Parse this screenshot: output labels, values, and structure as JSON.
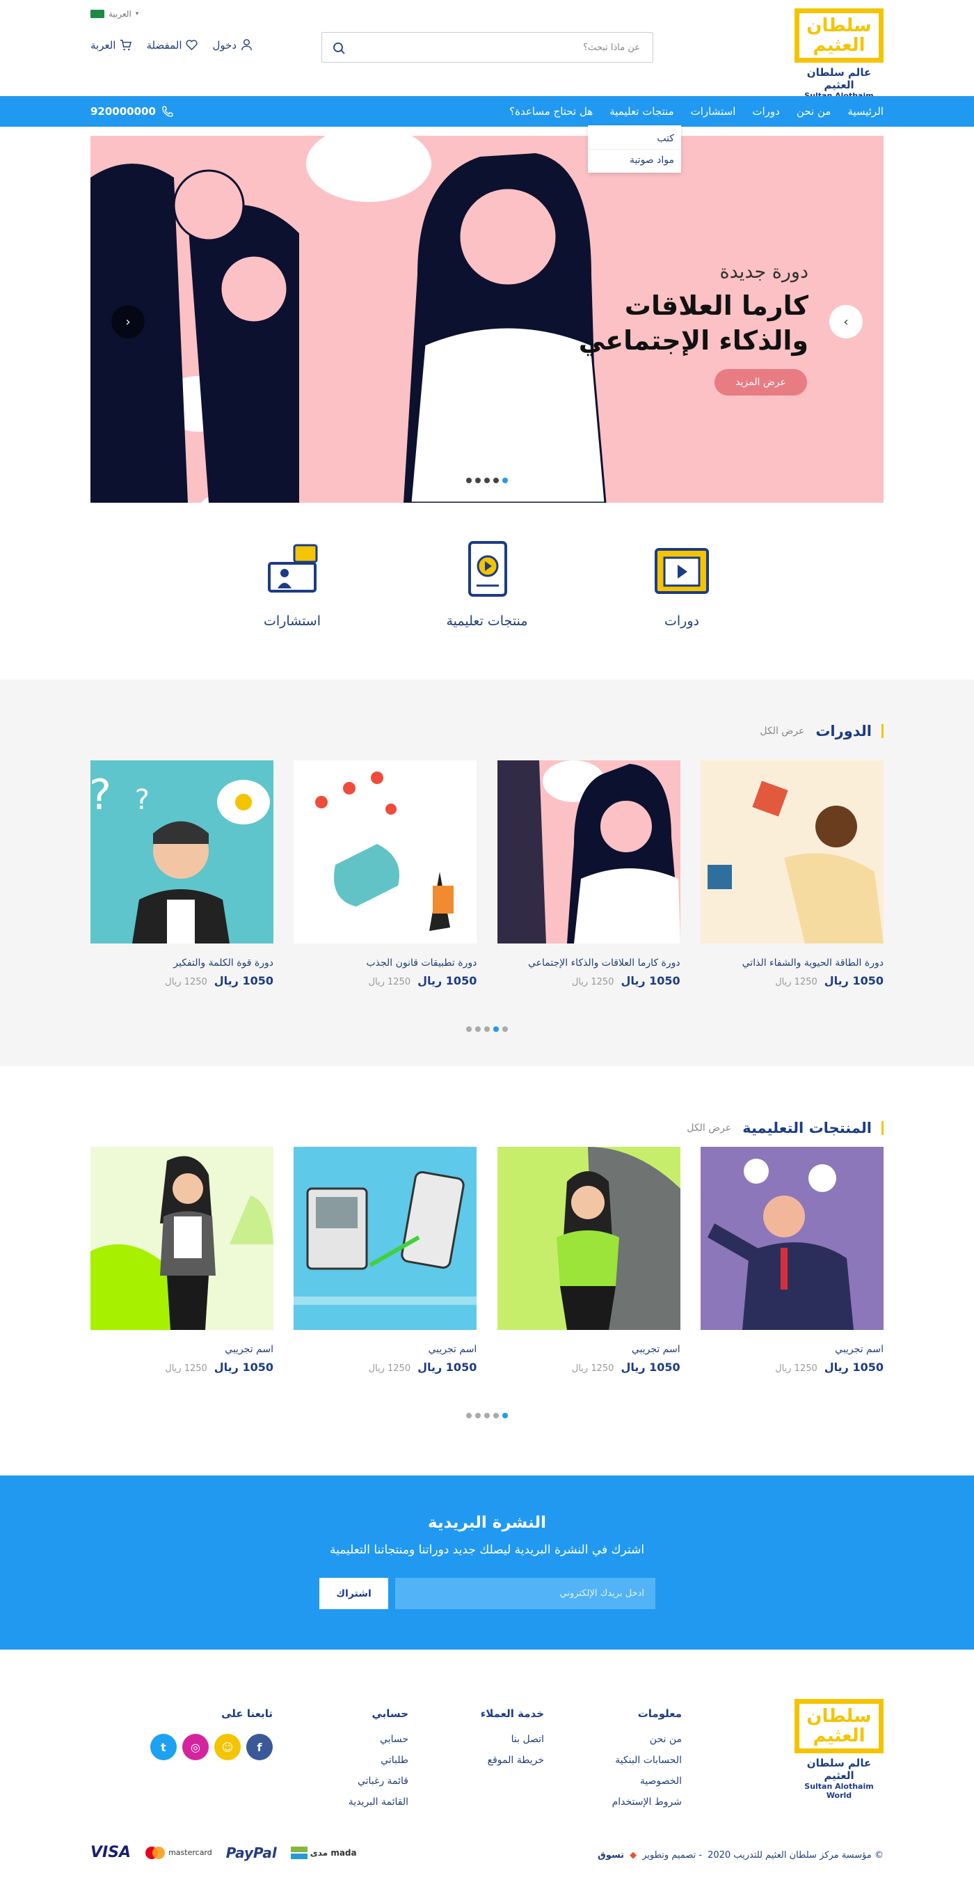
{
  "header": {
    "logo_ar": "عالم سلطان العثيم",
    "logo_en": "Sultan Alothaim World",
    "logo_mark": "سلطان العثيم",
    "search_placeholder": "عن ماذا تبحث؟",
    "language": "العربية",
    "login": "دخول",
    "favorites": "المفضلة",
    "cart": "العربة"
  },
  "nav": {
    "items": [
      "الرئيسية",
      "من نحن",
      "دورات",
      "استشارات",
      "منتجات تعليمية",
      "هل تحتاج مساعدة؟"
    ],
    "phone": "920000000",
    "dropdown": [
      "كتب",
      "مواد صوتية"
    ]
  },
  "hero": {
    "subtitle": "دورة جديدة",
    "title_line1": "كارما العلاقات",
    "title_line2": "والذكاء الإجتماعي",
    "button": "عرض المزيد",
    "active_slide": 1,
    "slide_count": 5
  },
  "categories": [
    {
      "label": "دورات",
      "icon": "video-folder-icon"
    },
    {
      "label": "منتجات تعليمية",
      "icon": "media-book-icon"
    },
    {
      "label": "استشارات",
      "icon": "consultation-icon"
    }
  ],
  "courses": {
    "title": "الدورات",
    "view_all": "عرض الكل",
    "items": [
      {
        "name": "دورة الطاقة الحيوية والشفاء الذاتي",
        "price": "1050 ريال",
        "old_price": "1250 ريال"
      },
      {
        "name": "دورة كارما العلاقات والذكاء الإجتماعي",
        "price": "1050 ريال",
        "old_price": "1250 ريال"
      },
      {
        "name": "دورة تطبيقات قانون الجذب",
        "price": "1050 ريال",
        "old_price": "1250 ريال"
      },
      {
        "name": "دورة قوة الكلمة والتفكير",
        "price": "1050 ريال",
        "old_price": "1250 ريال"
      }
    ]
  },
  "products": {
    "title": "المنتجات التعليمية",
    "view_all": "عرض الكل",
    "items": [
      {
        "name": "اسم تجريبي",
        "price": "1050 ريال",
        "old_price": "1250 ريال"
      },
      {
        "name": "اسم تجريبي",
        "price": "1050 ريال",
        "old_price": "1250 ريال"
      },
      {
        "name": "اسم تجريبي",
        "price": "1050 ريال",
        "old_price": "1250 ريال"
      },
      {
        "name": "اسم تجريبي",
        "price": "1050 ريال",
        "old_price": "1250 ريال"
      }
    ]
  },
  "newsletter": {
    "title": "النشرة البريدية",
    "text": "اشترك في النشرة البريدية ليصلك جديد دوراتنا ومنتجاتنا التعليمية",
    "placeholder": "ادخل بريدك الإلكتروني",
    "button": "اشتراك"
  },
  "footer": {
    "info_title": "معلومات",
    "info_links": [
      "من نحن",
      "الحسابات البنكية",
      "الخصوصية",
      "شروط الإستخدام"
    ],
    "service_title": "خدمة العملاء",
    "service_links": [
      "اتصل بنا",
      "خريطة الموقع"
    ],
    "account_title": "حسابي",
    "account_links": [
      "حسابي",
      "طلباتي",
      "قائمة رغباتي",
      "القائمة البريدية"
    ],
    "follow_title": "تابعنا على",
    "copyright": "© مؤسسة مركز سلطان العثيم للتدريب 2020",
    "credit": "- تصميم وتطوير",
    "credit_brand": "تسوق",
    "payments": [
      "VISA",
      "mastercard",
      "PayPal",
      "مدى mada"
    ]
  },
  "colors": {
    "primary": "#2199f0",
    "navy": "#1b3c85",
    "accent": "#f4c400",
    "hero_bg": "#fcc1c4"
  }
}
